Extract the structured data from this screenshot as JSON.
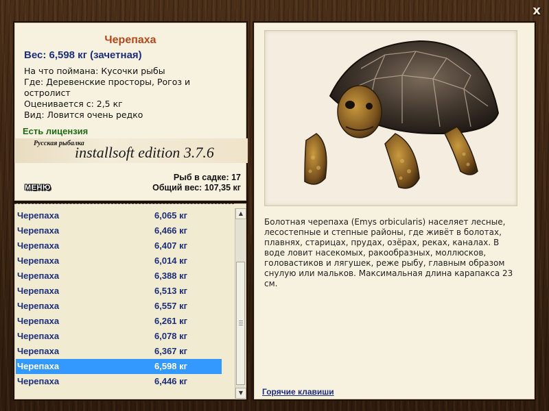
{
  "window": {
    "close_label": "x"
  },
  "fish": {
    "title": "Черепаха",
    "weight_line": "Вес: 6,598 кг (зачетная)",
    "info": [
      "На что поймана: Кусочки рыбы",
      "Где: Деревенские просторы, Рогоз и",
      "остролист",
      "Оценивается с: 2,5 кг",
      "Вид: Ловится очень редко"
    ],
    "license": "Есть лицензия"
  },
  "banner": {
    "small": "Русская рыбалка",
    "big": "installsoft edition  3.7.6"
  },
  "stats": {
    "in_net": "Рыб в садке: 17",
    "total_weight": "Общий вес: 107,35 кг"
  },
  "menu_label": "МЕНЮ",
  "catch_list": [
    {
      "name": "Черепаха",
      "weight": "6,065 кг"
    },
    {
      "name": "Черепаха",
      "weight": "6,466 кг"
    },
    {
      "name": "Черепаха",
      "weight": "6,407 кг"
    },
    {
      "name": "Черепаха",
      "weight": "6,014 кг"
    },
    {
      "name": "Черепаха",
      "weight": "6,388 кг"
    },
    {
      "name": "Черепаха",
      "weight": "6,513 кг"
    },
    {
      "name": "Черепаха",
      "weight": "6,557 кг"
    },
    {
      "name": "Черепаха",
      "weight": "6,261 кг"
    },
    {
      "name": "Черепаха",
      "weight": "6,078 кг"
    },
    {
      "name": "Черепаха",
      "weight": "6,367 кг"
    },
    {
      "name": "Черепаха",
      "weight": "6,598 кг"
    },
    {
      "name": "Черепаха",
      "weight": "6,446 кг"
    }
  ],
  "selected_index": 10,
  "description": "Болотная черепаха (Emys orbicularis) населяет лесные, лесостепные и степные районы, где живёт в болотах, плавнях, старицах, прудах, озёрах, реках, каналах. В воде ловит насекомых, ракообразных, моллюсков, головастиков и лягушек, реже рыбу, главным образом снулую или мальков. Максимальная длина карапакса 23 см.",
  "hotkeys_label": "Горячие клавиши",
  "colors": {
    "accent_title": "#b4481a",
    "list_text": "#1c2e7a",
    "selected_row": "#3399ff",
    "license": "#1e6b14"
  }
}
